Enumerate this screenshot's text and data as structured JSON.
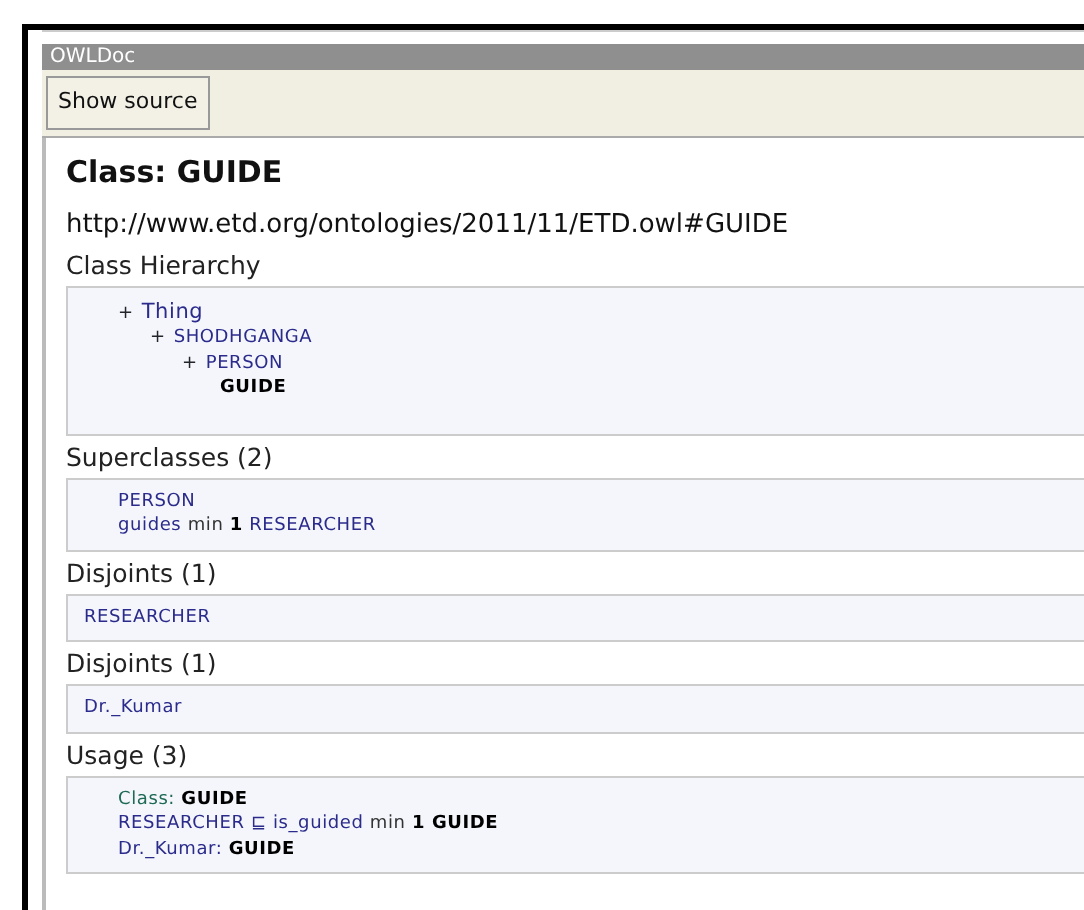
{
  "window": {
    "title": "OWLDoc"
  },
  "toolbar": {
    "buttons": [
      "Show source"
    ]
  },
  "heading": "Class: GUIDE",
  "uri": "http://www.etd.org/ontologies/2011/11/ETD.owl#GUIDE",
  "hierarchy": {
    "title": "Class Hierarchy",
    "tree": [
      {
        "marker": "+",
        "label": "Thing",
        "current": false,
        "children": [
          {
            "marker": "+",
            "label": "SHODHGANGA",
            "current": false,
            "children": [
              {
                "marker": "+",
                "label": "PERSON",
                "current": false,
                "children": [
                  {
                    "label": "GUIDE",
                    "current": true
                  }
                ]
              }
            ]
          }
        ]
      }
    ]
  },
  "sections": [
    {
      "title": "Superclasses (2)",
      "indented": true,
      "lines": [
        [
          {
            "text": "PERSON",
            "kind": "entity"
          }
        ],
        [
          {
            "text": "guides",
            "kind": "entity"
          },
          {
            "text": " min ",
            "kind": "keyword"
          },
          {
            "text": "1",
            "kind": "strong"
          },
          {
            "text": " RESEARCHER",
            "kind": "entity"
          }
        ]
      ]
    },
    {
      "title": "Disjoints (1)",
      "indented": false,
      "lines": [
        [
          {
            "text": "RESEARCHER",
            "kind": "entity"
          }
        ]
      ]
    },
    {
      "title": "Disjoints (1)",
      "indented": false,
      "lines": [
        [
          {
            "text": "Dr._Kumar",
            "kind": "entity"
          }
        ]
      ]
    },
    {
      "title": "Usage (3)",
      "indented": true,
      "lines": [
        [
          {
            "text": "Class: ",
            "kind": "frame"
          },
          {
            "text": "GUIDE",
            "kind": "strong"
          }
        ],
        [
          {
            "text": "RESEARCHER",
            "kind": "entity"
          },
          {
            "text": " ⊑ ",
            "kind": "entity"
          },
          {
            "text": "is_guided",
            "kind": "entity"
          },
          {
            "text": " min ",
            "kind": "keyword"
          },
          {
            "text": "1",
            "kind": "strong"
          },
          {
            "text": " GUIDE",
            "kind": "strong"
          }
        ],
        [
          {
            "text": "Dr._Kumar: ",
            "kind": "entity"
          },
          {
            "text": "GUIDE",
            "kind": "strong"
          }
        ]
      ]
    }
  ]
}
